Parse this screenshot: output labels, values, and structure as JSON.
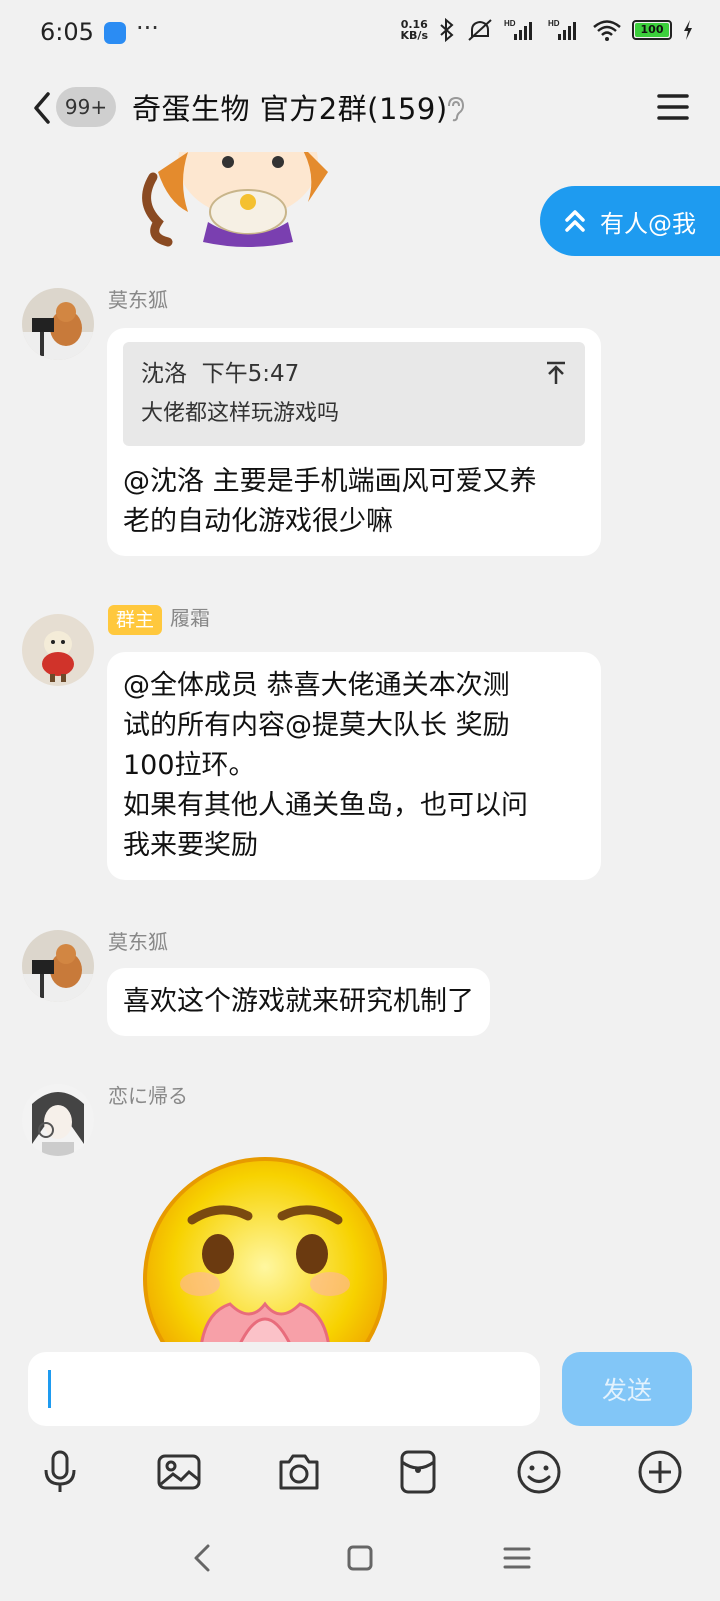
{
  "status_bar": {
    "time": "6:05",
    "more": "···",
    "net_speed_value": "0.16",
    "net_speed_unit": "KB/s",
    "battery": "100"
  },
  "header": {
    "unread_badge": "99+",
    "title": "奇蛋生物 官方2群(159)"
  },
  "at_me_label": "有人@我",
  "messages": [
    {
      "sender": "莫东狐",
      "quote_author": "沈洛",
      "quote_time": "下午5:47",
      "quote_text": "大佬都这样玩游戏吗",
      "lines": [
        "@沈洛 主要是手机端画风可爱又养",
        "老的自动化游戏很少嘛"
      ]
    },
    {
      "role_tag": "群主",
      "sender": "履霜",
      "lines": [
        "@全体成员 恭喜大佬通关本次测",
        "试的所有内容@提莫大队长 奖励",
        "100拉环。",
        "如果有其他人通关鱼岛，也可以问",
        "我来要奖励"
      ]
    },
    {
      "sender": "莫东狐",
      "lines": [
        "喜欢这个游戏就来研究机制了"
      ]
    },
    {
      "sender": "恋に帰る"
    }
  ],
  "input": {
    "send_label": "发送"
  }
}
